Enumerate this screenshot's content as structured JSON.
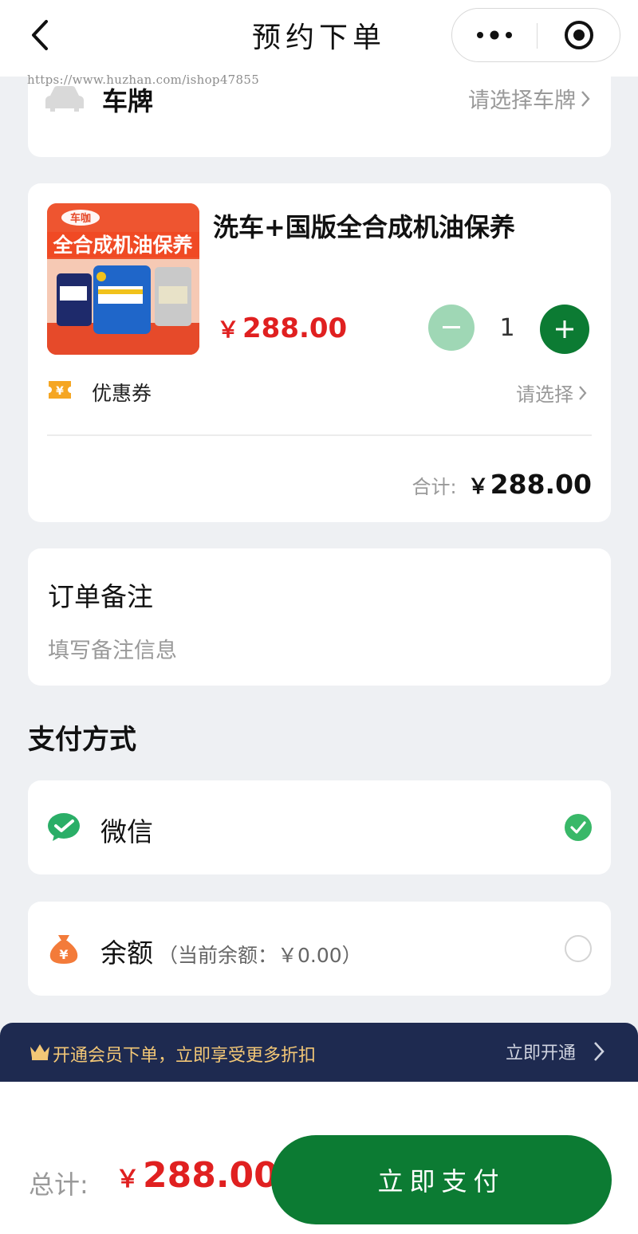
{
  "navbar": {
    "title": "预约下单"
  },
  "watermark": "https://www.huzhan.com/ishop47855",
  "plate": {
    "label": "车牌",
    "select_text": "请选择车牌"
  },
  "product": {
    "name": "洗车+国版全合成机油保养",
    "currency": "￥",
    "price": "288.00",
    "quantity": "1",
    "image_banner": "全合成机油保养",
    "image_brand": "车咖"
  },
  "coupon": {
    "label": "优惠券",
    "select_text": "请选择"
  },
  "subtotal": {
    "label": "合计:",
    "currency": "￥",
    "value": "288.00"
  },
  "notes": {
    "title": "订单备注",
    "placeholder": "填写备注信息"
  },
  "payment": {
    "title": "支付方式",
    "methods": [
      {
        "label": "微信",
        "selected": true
      },
      {
        "label": "余额",
        "detail": "（当前余额：￥0.00）",
        "selected": false
      }
    ]
  },
  "member": {
    "text": "开通会员下单，立即享受更多折扣",
    "action": "立即开通"
  },
  "footer": {
    "total_label": "总计:",
    "currency": "￥",
    "total_value": "288.00",
    "pay_button": "立即支付"
  },
  "colors": {
    "primary": "#0c7b33",
    "price": "#e02020",
    "member_bg": "#1e2a50",
    "member_text": "#f3c776"
  }
}
